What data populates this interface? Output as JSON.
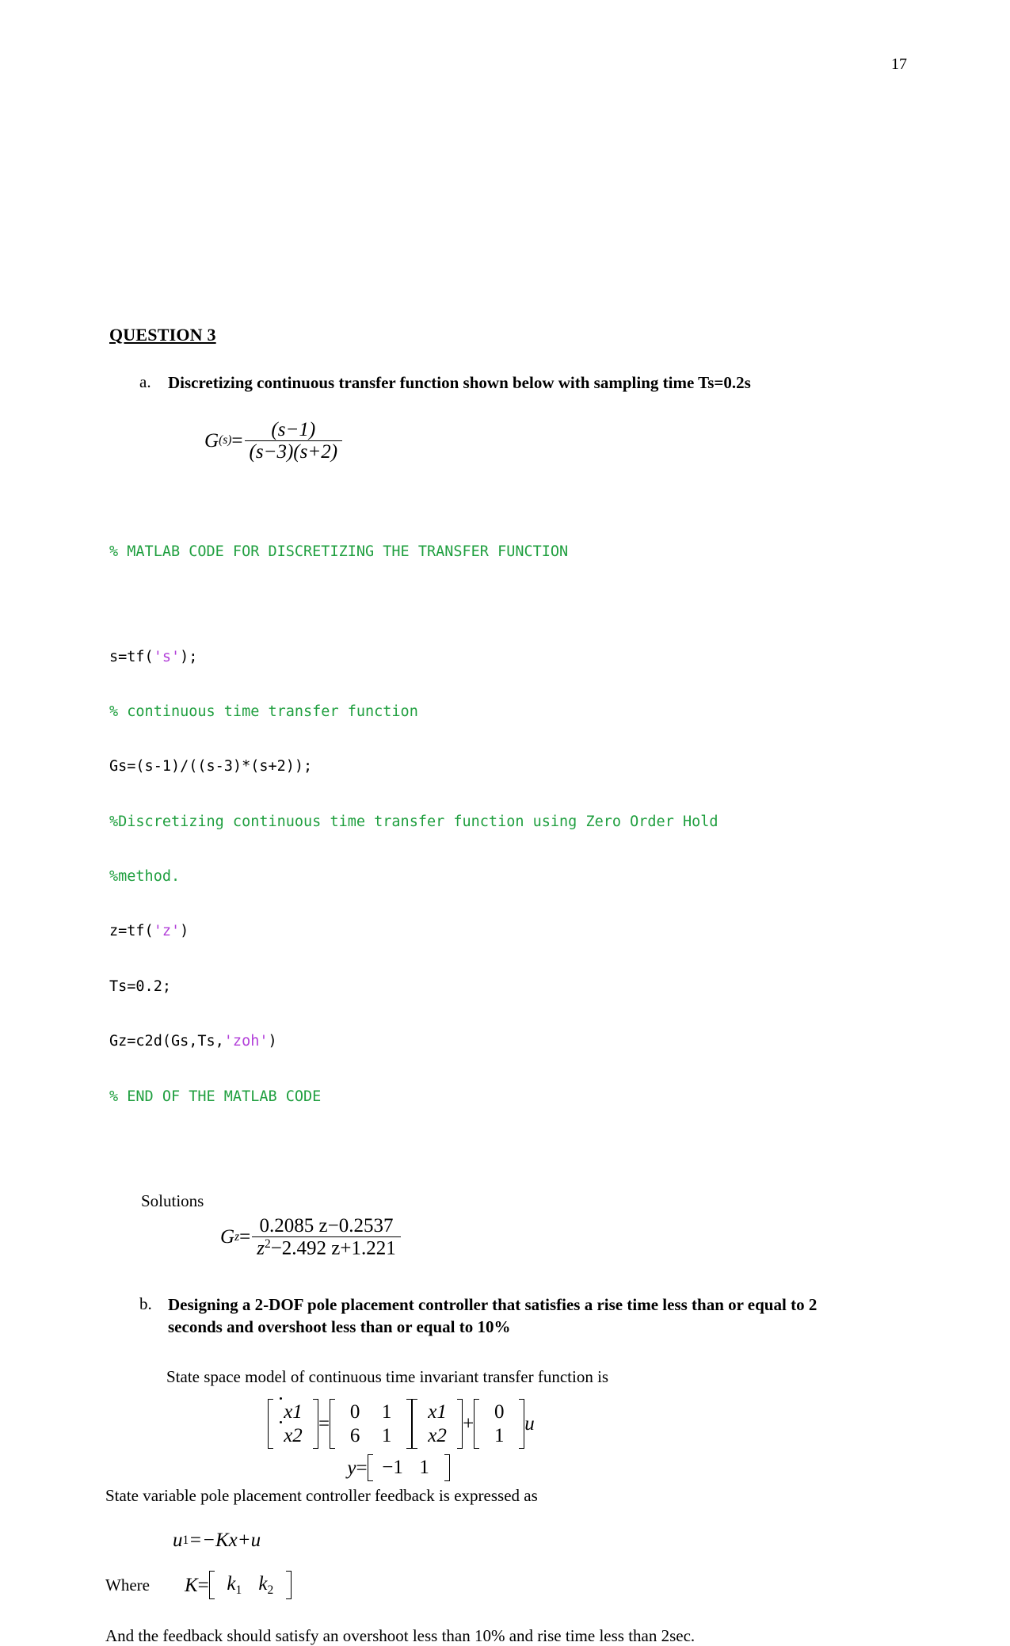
{
  "page": {
    "number": "17"
  },
  "heading": {
    "title": "QUESTION 3"
  },
  "part_a": {
    "marker": "a.",
    "text": "Discretizing continuous transfer function shown below with sampling time Ts=0.2s",
    "formula": {
      "lhs": "G",
      "lhs_sub": "(s)",
      "eq": "=",
      "numerator": "(s−1)",
      "denominator": "(s−3)(s+2)"
    }
  },
  "code": {
    "lines": [
      {
        "type": "comment",
        "text": "% MATLAB CODE FOR DISCRETIZING THE TRANSFER FUNCTION"
      },
      {
        "type": "blank",
        "text": ""
      },
      {
        "type": "mixed",
        "pre": "s=tf(",
        "str": "'s'",
        "post": ");"
      },
      {
        "type": "comment",
        "text": "% continuous time transfer function"
      },
      {
        "type": "plain",
        "text": "Gs=(s-1)/((s-3)*(s+2));"
      },
      {
        "type": "comment",
        "text": "%Discretizing continuous time transfer function using Zero Order Hold"
      },
      {
        "type": "comment",
        "text": "%method."
      },
      {
        "type": "mixed",
        "pre": "z=tf(",
        "str": "'z'",
        "post": ")"
      },
      {
        "type": "plain",
        "text": "Ts=0.2;"
      },
      {
        "type": "mixed",
        "pre": "Gz=c2d(Gs,Ts,",
        "str": "'zoh'",
        "post": ")"
      },
      {
        "type": "comment",
        "text": "% END OF THE MATLAB CODE"
      }
    ],
    "comment_color": "#1f9f3f",
    "string_color": "#b23fd9"
  },
  "solutions": {
    "label": "Solutions",
    "formula": {
      "lhs": "G",
      "lhs_sub": "z",
      "eq": "=",
      "numerator": "0.2085 z−0.2537",
      "denominator_a": "z",
      "denominator_sup": "2",
      "denominator_b": "−2.492 z+1.221"
    }
  },
  "part_b": {
    "marker": "b.",
    "text": "Designing a 2-DOF pole placement controller that satisfies a rise time less than or equal to 2 seconds and overshoot less than or equal to 10%",
    "intro": "State space model of continuous time invariant transfer function is",
    "state_space": {
      "lhs_rows": [
        [
          "x1"
        ],
        [
          "x2"
        ]
      ],
      "eq": "=",
      "A_rows": [
        [
          "0",
          "1"
        ],
        [
          "6",
          "1"
        ]
      ],
      "x_rows": [
        [
          "x1"
        ],
        [
          "x2"
        ]
      ],
      "plus": "+",
      "B_rows": [
        [
          "0"
        ],
        [
          "1"
        ]
      ],
      "u": "u"
    },
    "output_eq": {
      "lhs": "y",
      "eq": "=",
      "C_row": [
        "−1",
        "1"
      ]
    },
    "feedback_intro": "State variable pole placement controller feedback is expressed as",
    "feedback_eq": {
      "lhs": "u",
      "lhs_sub": "1",
      "rhs": "=−Kx+u"
    },
    "where_label": "Where",
    "gain_eq": {
      "lhs": "K",
      "eq": "=",
      "row": [
        "k",
        "k"
      ],
      "subs": [
        "1",
        "2"
      ]
    },
    "closing": "And the feedback should satisfy an overshoot less than 10% and rise time less than 2sec."
  }
}
